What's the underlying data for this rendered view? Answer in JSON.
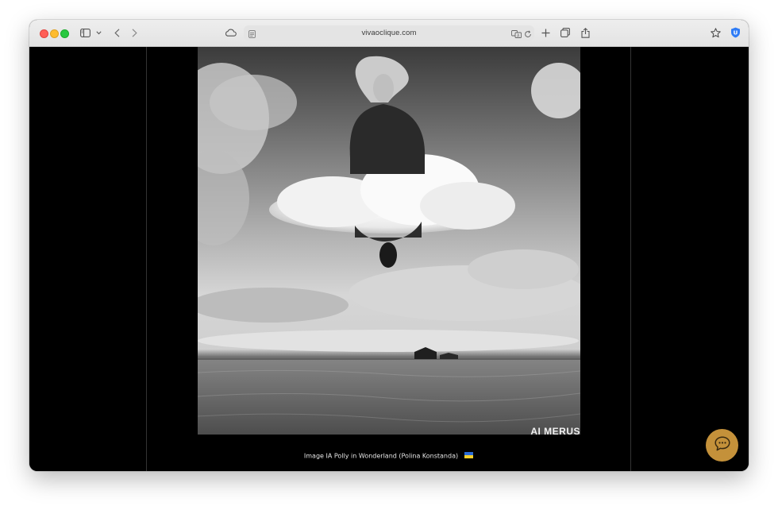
{
  "browser": {
    "url": "vivaoclique.com",
    "icons": [
      "sidebar-icon",
      "chevron-down-icon",
      "back-icon",
      "forward-icon",
      "cloud-icon",
      "page-icon",
      "translate-icon",
      "reload-icon",
      "new-tab-icon",
      "tabs-overview-icon",
      "share-icon",
      "bookmark-star-icon",
      "extension-shield-icon"
    ]
  },
  "photo": {
    "watermark": "AI MERUS"
  },
  "caption": {
    "text": "Image IA Polly in Wonderland (Polina Konstanda)"
  },
  "chat": {
    "icon": "chat-bubble-icon",
    "color": "#c4913a"
  }
}
